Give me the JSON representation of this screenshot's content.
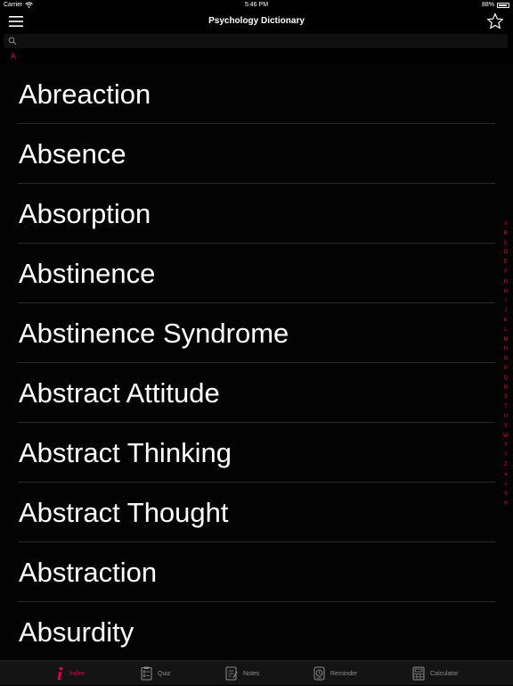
{
  "status_bar": {
    "carrier": "Carrier",
    "time": "5:46 PM",
    "battery": "88%",
    "battery_level": 0.88
  },
  "nav": {
    "title": "Psychology Dictionary"
  },
  "search": {
    "placeholder": ""
  },
  "section": {
    "letter": "A"
  },
  "terms": [
    "Abreaction",
    "Absence",
    "Absorption",
    "Abstinence",
    "Abstinence Syndrome",
    "Abstract Attitude",
    "Abstract Thinking",
    "Abstract Thought",
    "Abstraction",
    "Absurdity"
  ],
  "index_letters": [
    "A",
    "B",
    "C",
    "D",
    "E",
    "F",
    "G",
    "H",
    "I",
    "J",
    "K",
    "L",
    "M",
    "N",
    "O",
    "P",
    "Q",
    "R",
    "S",
    "T",
    "U",
    "V",
    "W",
    "X",
    "Y",
    "Z",
    "a",
    "c",
    "q",
    "w"
  ],
  "tabs": [
    {
      "label": "Index",
      "icon": "info-icon",
      "active": true
    },
    {
      "label": "Quiz",
      "icon": "quiz-icon",
      "active": false
    },
    {
      "label": "Notes",
      "icon": "notes-icon",
      "active": false
    },
    {
      "label": "Reminder",
      "icon": "reminder-icon",
      "active": false
    },
    {
      "label": "Calculator",
      "icon": "calculator-icon",
      "active": false
    }
  ],
  "colors": {
    "accent": "#e0004d",
    "background": "#000000",
    "separator": "#2b2b2b"
  }
}
